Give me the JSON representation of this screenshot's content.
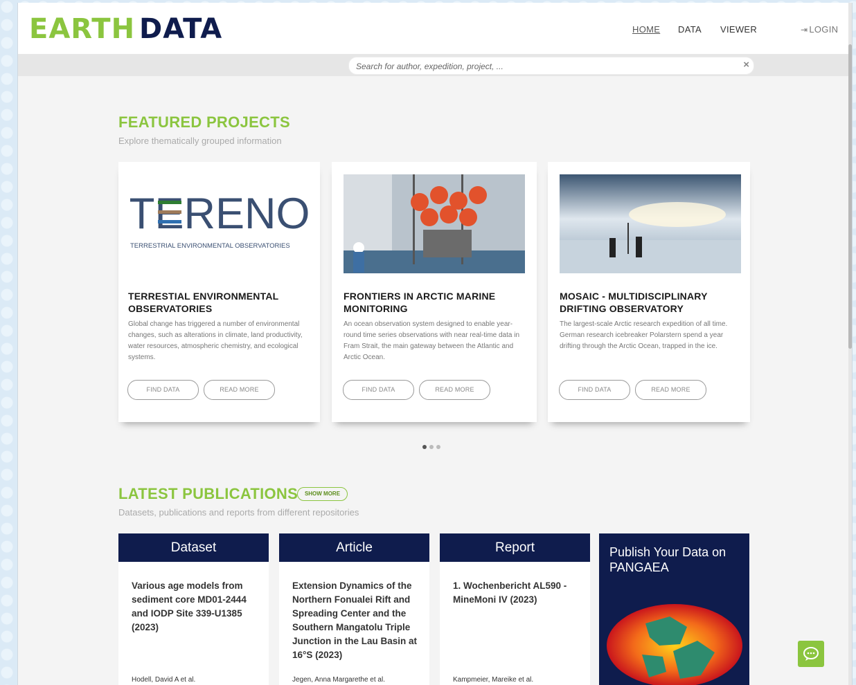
{
  "header": {
    "logo": {
      "part1": "EARTH",
      "part2": "DATA"
    },
    "nav": [
      {
        "label": "HOME"
      },
      {
        "label": "DATA"
      },
      {
        "label": "VIEWER"
      }
    ],
    "login_label": "LOGIN"
  },
  "search": {
    "placeholder": "Search for author, expedition, project, ...",
    "clear_symbol": "×"
  },
  "featured": {
    "title": "FEATURED PROJECTS",
    "subtitle": "Explore thematically grouped information",
    "cards": [
      {
        "title": "TERRESTIAL ENVIRONMENTAL OBSERVATORIES",
        "description": "Global change has triggered a number of environmental changes, such as alterations in climate, land productivity, water resources, atmospheric chemistry, and ecological systems.",
        "logo_text": "TERENO",
        "logo_subtext": "TERRESTRIAL ENVIRONMENTAL OBSERVATORIES",
        "find_data": "FIND DATA",
        "read_more": "READ MORE"
      },
      {
        "title": "FRONTIERS IN ARCTIC MARINE MONITORING",
        "description": "An ocean observation system designed to enable year-round time series observations with near real-time data in Fram Strait, the main gateway between the Atlantic and Arctic Ocean.",
        "find_data": "FIND DATA",
        "read_more": "READ MORE"
      },
      {
        "title": "MOSAIC - MULTIDISCIPLINARY DRIFTING OBSERVATORY",
        "description": "The largest-scale Arctic research expedition of all time. German research icebreaker Polarstern spend a year drifting through the Arctic Ocean, trapped in the ice.",
        "find_data": "FIND DATA",
        "read_more": "READ MORE"
      }
    ],
    "carousel": {
      "count": 3,
      "active": 1
    }
  },
  "publications": {
    "title": "LATEST PUBLICATIONS",
    "show_more": "SHOW MORE",
    "subtitle": "Datasets, publications and reports from different repositories",
    "items": [
      {
        "type": "Dataset",
        "title": "Various age models from sediment core MD01-2444 and IODP Site 339-U1385 (2023)",
        "author": "Hodell, David A et al."
      },
      {
        "type": "Article",
        "title": "Extension Dynamics of the Northern Fonualei Rift and Spreading Center and the Southern Mangatolu Triple Junction in the Lau Basin at 16°S (2023)",
        "author": "Jegen, Anna Margarethe et al."
      },
      {
        "type": "Report",
        "title": "1. Wochenbericht AL590 - MineMoni IV (2023)",
        "author": "Kampmeier, Mareike et al."
      }
    ],
    "publish_box": {
      "title": "Publish Your Data on PANGAEA"
    }
  },
  "colors": {
    "accent": "#8bc53f",
    "navy": "#0f1c4d"
  }
}
